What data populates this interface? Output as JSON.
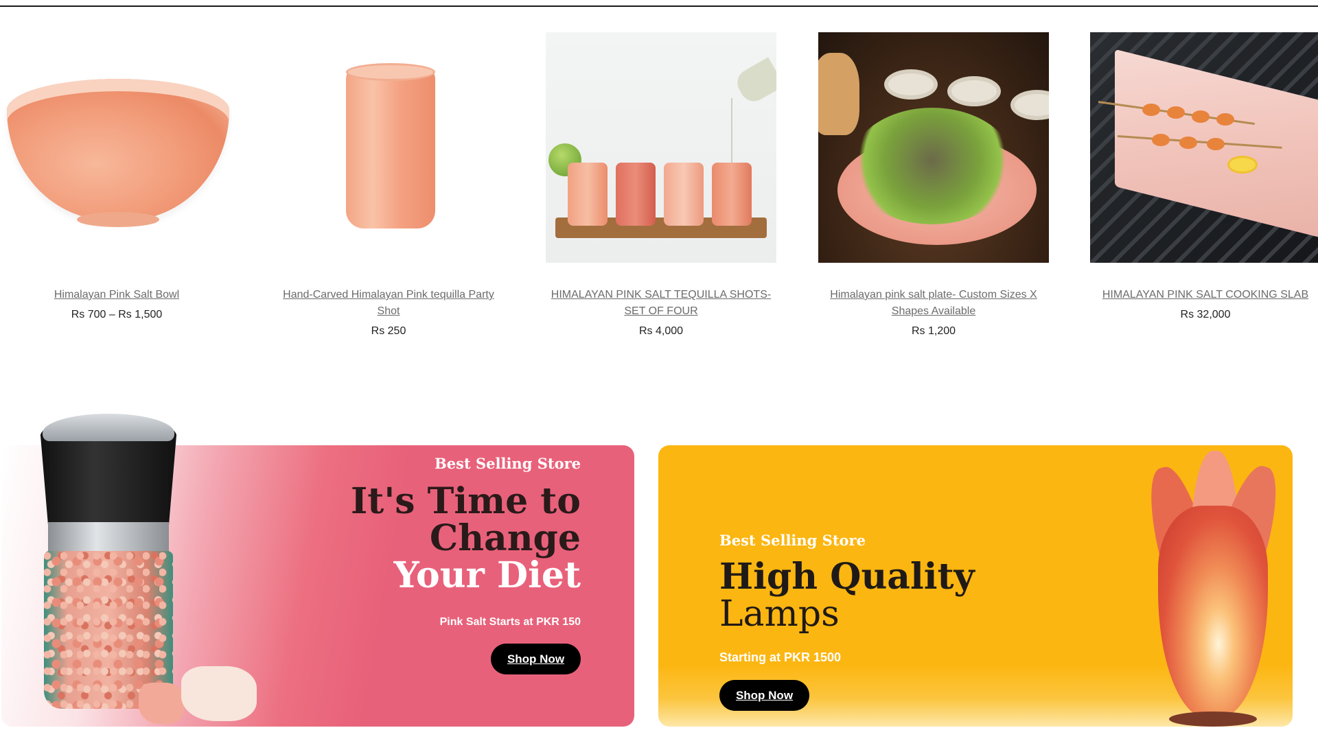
{
  "products": [
    {
      "title": "Himalayan Pink Salt Bowl",
      "price": "Rs 700 – Rs 1,500",
      "image": "salt-bowl-image"
    },
    {
      "title": "Hand-Carved Himalayan Pink tequilla Party Shot",
      "price": "Rs 250",
      "image": "salt-shot-glass-image"
    },
    {
      "title": "HIMALAYAN PINK SALT TEQUILLA SHOTS- SET OF FOUR",
      "price": "Rs 4,000",
      "image": "tequila-shots-set-image"
    },
    {
      "title": "Himalayan pink salt plate- Custom Sizes X Shapes Available",
      "price": "Rs 1,200",
      "image": "salt-plate-image"
    },
    {
      "title": "HIMALAYAN PINK SALT COOKING SLAB",
      "price": "Rs 32,000",
      "image": "cooking-slab-image"
    }
  ],
  "banner_pink": {
    "kicker": "Best Selling Store",
    "headline_line1": "It's Time to",
    "headline_line2": "Change",
    "headline_line3": "Your Diet",
    "subtext": "Pink Salt Starts at PKR 150",
    "button": "Shop Now",
    "image": "salt-grinder-image",
    "color": "#e8617a"
  },
  "banner_yellow": {
    "kicker": "Best Selling Store",
    "headline_line1": "High Quality",
    "headline_line2": "Lamps",
    "subtext": "Starting at PKR 1500",
    "button": "Shop Now",
    "image": "salt-lamp-image",
    "color": "#fcb611"
  }
}
